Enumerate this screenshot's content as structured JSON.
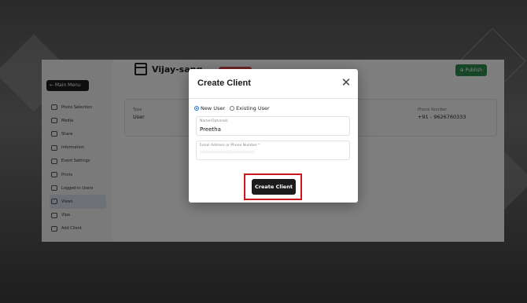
{
  "sidebar": {
    "main_menu": "← Main Menu",
    "items": [
      {
        "label": "Photo Selection",
        "icon": "photo-icon"
      },
      {
        "label": "Media",
        "icon": "media-icon"
      },
      {
        "label": "Share",
        "icon": "share-icon"
      },
      {
        "label": "Information",
        "icon": "info-icon"
      },
      {
        "label": "Event Settings",
        "icon": "settings-icon"
      },
      {
        "label": "Prints",
        "icon": "print-icon"
      },
      {
        "label": "Logged-in Users",
        "icon": "users-icon"
      },
      {
        "label": "Views",
        "icon": "eye-icon",
        "active": true
      },
      {
        "label": "Vipa",
        "icon": "user-icon"
      },
      {
        "label": "Add Client",
        "icon": "add-client-icon"
      }
    ]
  },
  "header": {
    "event_title": "Vijay-sang…",
    "publish": "⊕ Publish"
  },
  "info_card": {
    "type_label": "Type",
    "type_value": "User",
    "phone_label": "Phone Number",
    "phone_value": "+91 - 9626760333"
  },
  "modal": {
    "title": "Create Client",
    "close": "✕",
    "radio_new": "New User",
    "radio_existing": "Existing User",
    "selected": "new",
    "name_label": "Name(Optional)",
    "name_value": "Preetha",
    "email_label": "Email Address or Phone Number *",
    "email_value": "••••••••••••••••••••••",
    "submit": "Create Client"
  },
  "colors": {
    "accent": "#1a73e8",
    "highlight": "#d0121b",
    "publish": "#2d8a4e",
    "button": "#1c1c1c"
  }
}
